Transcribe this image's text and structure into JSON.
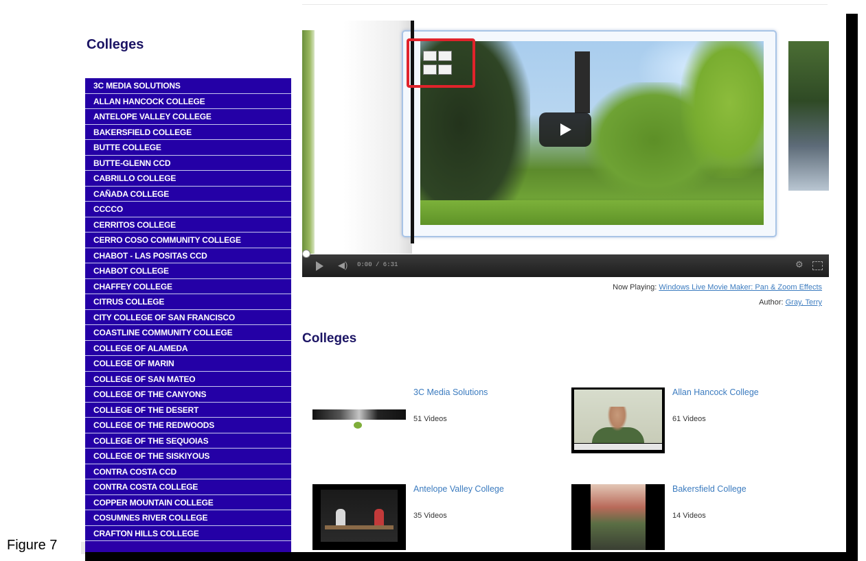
{
  "figure_caption": "Figure 7",
  "sidebar": {
    "heading": "Colleges",
    "items": [
      "3C MEDIA SOLUTIONS",
      "ALLAN HANCOCK COLLEGE",
      "ANTELOPE VALLEY COLLEGE",
      "BAKERSFIELD COLLEGE",
      "BUTTE COLLEGE",
      "BUTTE-GLENN CCD",
      "CABRILLO COLLEGE",
      "CAÑADA COLLEGE",
      "CCCCO",
      "CERRITOS COLLEGE",
      "CERRO COSO COMMUNITY COLLEGE",
      "CHABOT - LAS POSITAS CCD",
      "CHABOT COLLEGE",
      "CHAFFEY COLLEGE",
      "CITRUS COLLEGE",
      "CITY COLLEGE OF SAN FRANCISCO",
      "COASTLINE COMMUNITY COLLEGE",
      "COLLEGE OF ALAMEDA",
      "COLLEGE OF MARIN",
      "COLLEGE OF SAN MATEO",
      "COLLEGE OF THE CANYONS",
      "COLLEGE OF THE DESERT",
      "COLLEGE OF THE REDWOODS",
      "COLLEGE OF THE SEQUOIAS",
      "COLLEGE OF THE SISKIYOUS",
      "CONTRA COSTA CCD",
      "CONTRA COSTA COLLEGE",
      "COPPER MOUNTAIN COLLEGE",
      "COSUMNES RIVER COLLEGE",
      "CRAFTON HILLS COLLEGE"
    ]
  },
  "player": {
    "time": "0:00 / 6:31",
    "volume_icon": "speaker-icon",
    "gear_icon": "gear-icon",
    "fullscreen_icon": "fullscreen-icon"
  },
  "now_playing": {
    "label": "Now Playing: ",
    "title": "Windows Live Movie Maker: Pan & Zoom Effects",
    "author_label": "Author: ",
    "author": "Gray, Terry"
  },
  "main": {
    "heading": "Colleges",
    "cards": [
      {
        "name": "3C Media Solutions",
        "count": "51 Videos"
      },
      {
        "name": "Allan Hancock College",
        "count": "61 Videos"
      },
      {
        "name": "Antelope Valley College",
        "count": "35 Videos"
      },
      {
        "name": "Bakersfield College",
        "count": "14 Videos"
      }
    ]
  },
  "colors": {
    "sidebar_bg": "#2400a6",
    "heading": "#1b1464",
    "link": "#3b7bbf",
    "highlight": "#e0232b"
  }
}
